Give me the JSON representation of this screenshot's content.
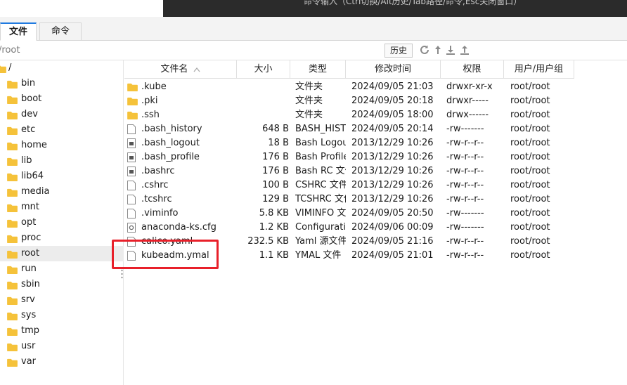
{
  "terminal": {
    "hint": "命令输入（Ctrl切换/Alt历史/Tab路径/命令,Esc关闭窗口）"
  },
  "tabs": {
    "file": "文件",
    "command": "命令"
  },
  "pathbar": {
    "path": "/root",
    "history_label": "历史"
  },
  "tree": {
    "root_label": "/",
    "items": [
      "bin",
      "boot",
      "dev",
      "etc",
      "home",
      "lib",
      "lib64",
      "media",
      "mnt",
      "opt",
      "proc",
      "root",
      "run",
      "sbin",
      "srv",
      "sys",
      "tmp",
      "usr",
      "var"
    ],
    "selected": "root"
  },
  "columns": {
    "name": "文件名",
    "size": "大小",
    "type": "类型",
    "mtime": "修改时间",
    "perm": "权限",
    "owner": "用户/用户组"
  },
  "files": [
    {
      "icon": "folder-icon",
      "name": ".kube",
      "size": "",
      "type": "文件夹",
      "mtime": "2024/09/05 21:03",
      "perm": "drwxr-xr-x",
      "owner": "root/root"
    },
    {
      "icon": "folder-icon",
      "name": ".pki",
      "size": "",
      "type": "文件夹",
      "mtime": "2024/09/05 20:18",
      "perm": "drwxr-----",
      "owner": "root/root"
    },
    {
      "icon": "folder-icon",
      "name": ".ssh",
      "size": "",
      "type": "文件夹",
      "mtime": "2024/09/05 18:00",
      "perm": "drwx------",
      "owner": "root/root"
    },
    {
      "icon": "file-icon",
      "name": ".bash_history",
      "size": "648 B",
      "type": "BASH_HISTORY",
      "mtime": "2024/09/05 20:14",
      "perm": "-rw-------",
      "owner": "root/root"
    },
    {
      "icon": "script-file-icon",
      "name": ".bash_logout",
      "size": "18 B",
      "type": "Bash Logout",
      "mtime": "2013/12/29 10:26",
      "perm": "-rw-r--r--",
      "owner": "root/root"
    },
    {
      "icon": "script-file-icon",
      "name": ".bash_profile",
      "size": "176 B",
      "type": "Bash Profile",
      "mtime": "2013/12/29 10:26",
      "perm": "-rw-r--r--",
      "owner": "root/root"
    },
    {
      "icon": "script-file-icon",
      "name": ".bashrc",
      "size": "176 B",
      "type": "Bash RC 文件",
      "mtime": "2013/12/29 10:26",
      "perm": "-rw-r--r--",
      "owner": "root/root"
    },
    {
      "icon": "file-icon",
      "name": ".cshrc",
      "size": "100 B",
      "type": "CSHRC 文件",
      "mtime": "2013/12/29 10:26",
      "perm": "-rw-r--r--",
      "owner": "root/root"
    },
    {
      "icon": "file-icon",
      "name": ".tcshrc",
      "size": "129 B",
      "type": "TCSHRC 文件",
      "mtime": "2013/12/29 10:26",
      "perm": "-rw-r--r--",
      "owner": "root/root"
    },
    {
      "icon": "file-icon",
      "name": ".viminfo",
      "size": "5.8 KB",
      "type": "VIMINFO 文件",
      "mtime": "2024/09/05 20:50",
      "perm": "-rw-------",
      "owner": "root/root"
    },
    {
      "icon": "config-file-icon",
      "name": "anaconda-ks.cfg",
      "size": "1.2 KB",
      "type": "Configuration",
      "mtime": "2024/09/06 00:09",
      "perm": "-rw-------",
      "owner": "root/root"
    },
    {
      "icon": "file-icon",
      "name": "calico.yaml",
      "size": "232.5 KB",
      "type": "Yaml 源文件",
      "mtime": "2024/09/05 21:16",
      "perm": "-rw-r--r--",
      "owner": "root/root"
    },
    {
      "icon": "file-icon",
      "name": "kubeadm.ymal",
      "size": "1.1 KB",
      "type": "YMAL 文件",
      "mtime": "2024/09/05 21:01",
      "perm": "-rw-r--r--",
      "owner": "root/root"
    }
  ],
  "colors": {
    "folder": "#f5c23a",
    "accent": "#1f7ae0",
    "highlight": "#e8202a",
    "selected_bg": "#ececec"
  }
}
